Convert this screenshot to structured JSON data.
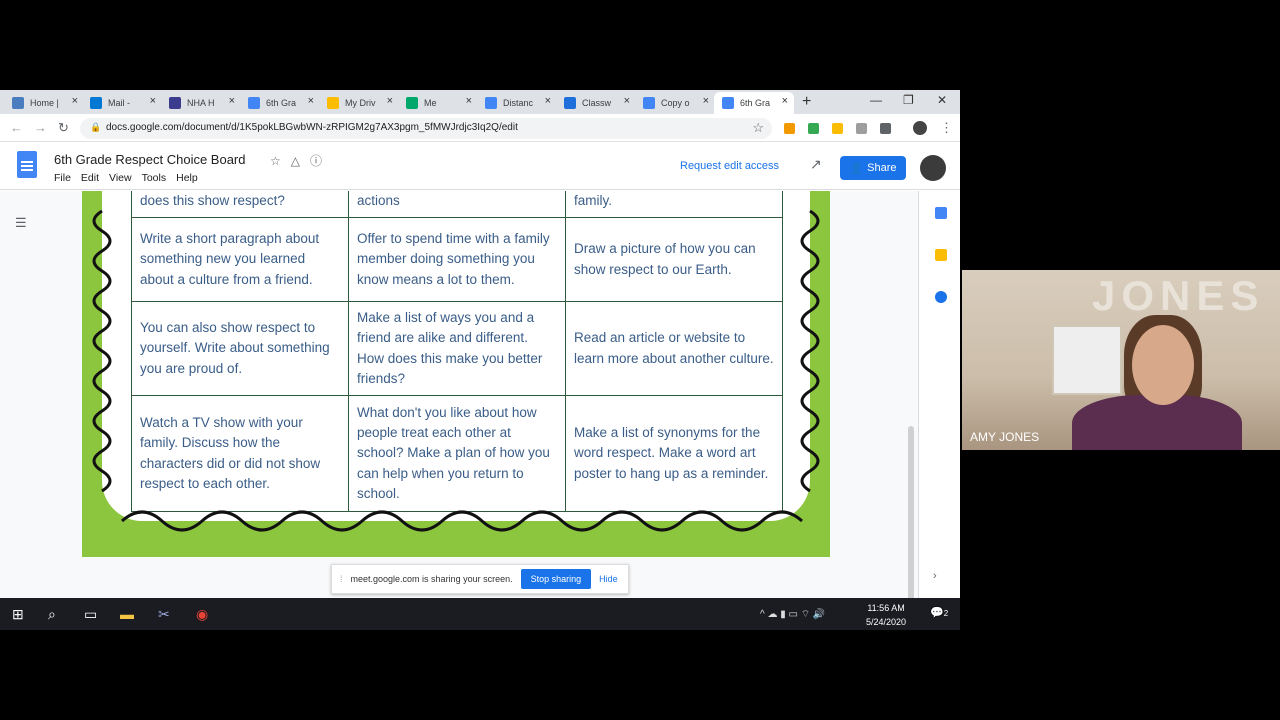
{
  "browser": {
    "tabs": [
      {
        "label": "Home |",
        "color": "#4a7dbf",
        "active": false
      },
      {
        "label": "Mail -",
        "color": "#0078d4",
        "active": false
      },
      {
        "label": "NHA H",
        "color": "#3b3b8f",
        "active": false
      },
      {
        "label": "6th Gra",
        "color": "#4285f4",
        "active": false
      },
      {
        "label": "My Driv",
        "color": "#fbbc04",
        "active": false
      },
      {
        "label": "Me",
        "color": "#00a86b",
        "active": false
      },
      {
        "label": "Distanc",
        "color": "#4285f4",
        "active": false
      },
      {
        "label": "Classw",
        "color": "#1e6fd9",
        "active": false
      },
      {
        "label": "Copy o",
        "color": "#4285f4",
        "active": false
      },
      {
        "label": "6th Gra",
        "color": "#4285f4",
        "active": true
      }
    ],
    "url": "docs.google.com/document/d/1K5pokLBGwbWN-zRPIGM2g7AX3pgm_5fMWJrdjc3Iq2Q/edit"
  },
  "doc": {
    "title": "6th Grade Respect Choice Board",
    "menu": [
      "File",
      "Edit",
      "View",
      "Tools",
      "Help"
    ],
    "request_access": "Request edit access",
    "share_label": "Share"
  },
  "board": {
    "top_row": [
      "does this show respect?",
      "actions",
      "family."
    ],
    "rows": [
      [
        "Write a short paragraph about something new you learned about a culture from a friend.",
        "Offer to spend time with a family member doing something you know means a lot to them.",
        "Draw a picture of how you can show respect to our Earth."
      ],
      [
        "You can also show respect to yourself. Write about something you are proud of.",
        "Make a list of ways you and a friend are alike and different. How does this make you better friends?",
        "Read an article or website to learn more about another culture."
      ],
      [
        "Watch a TV show with your family. Discuss how the characters did or did not show respect to each other.",
        "What don't you like about how people treat each other at school? Make a plan of how you can help when you return to school.",
        "Make a list of synonyms for the word respect. Make a word art poster to hang up as a reminder."
      ]
    ]
  },
  "sharing_bar": {
    "message": "meet.google.com is sharing your screen.",
    "stop_label": "Stop sharing",
    "hide_label": "Hide"
  },
  "taskbar": {
    "time": "11:56 AM",
    "date": "5/24/2020",
    "notifications": "2"
  },
  "video": {
    "participant": "AMY JONES",
    "wall_text": "JONES"
  }
}
